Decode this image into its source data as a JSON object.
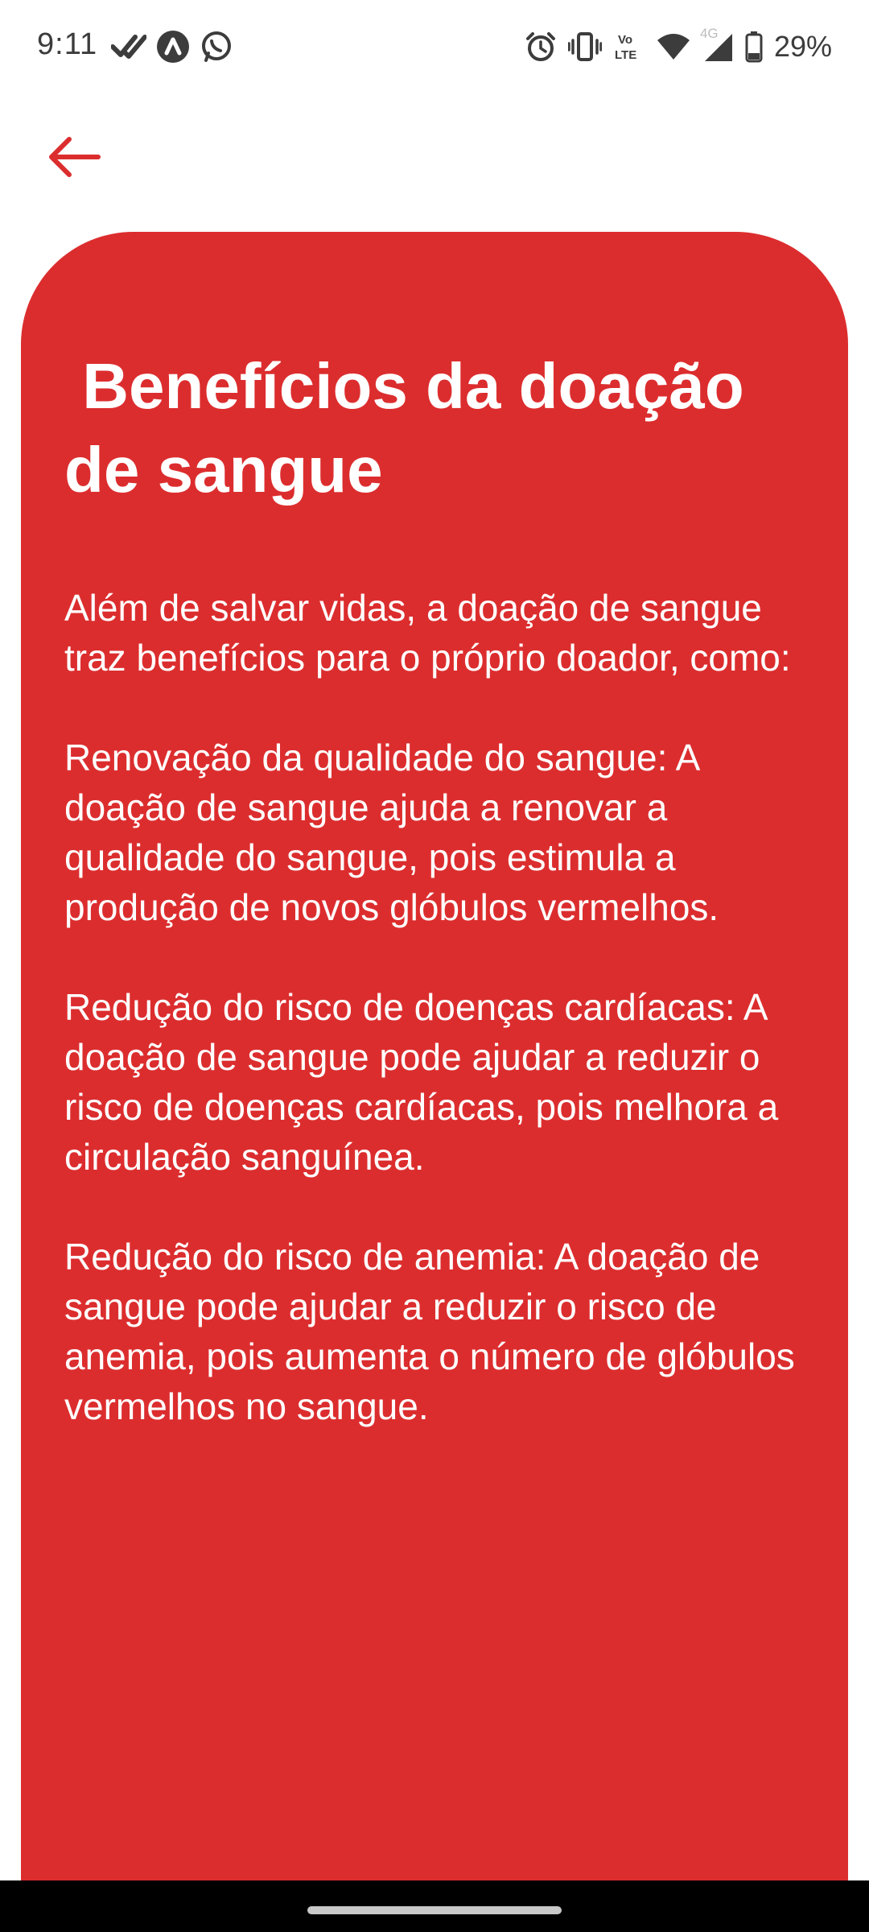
{
  "status_bar": {
    "time": "9:11",
    "battery": "29%",
    "network": "4G",
    "icons": [
      "check-done-icon",
      "arrow-app-icon",
      "whatsapp-icon",
      "alarm-icon",
      "vibrate-icon",
      "volte-icon",
      "wifi-icon",
      "signal-icon",
      "battery-icon"
    ]
  },
  "header": {
    "back_icon": "arrow-left-icon"
  },
  "card": {
    "title": " Benefícios da doação de sangue",
    "paragraphs": [
      "Além de salvar vidas, a doação de sangue traz benefícios para o próprio doador, como:",
      "Renovação da qualidade do sangue: A doação de sangue ajuda a renovar a qualidade do sangue, pois estimula a produção de novos glóbulos vermelhos.",
      "Redução do risco de doenças cardíacas: A doação de sangue pode ajudar a reduzir o risco de doenças cardíacas, pois melhora a circulação sanguínea.",
      "Redução do risco de anemia: A doação de sangue pode ajudar a reduzir o risco de anemia, pois aumenta o número de glóbulos vermelhos no sangue."
    ]
  },
  "colors": {
    "accent": "#dc2d2e",
    "text_on_accent": "#ffffff"
  }
}
